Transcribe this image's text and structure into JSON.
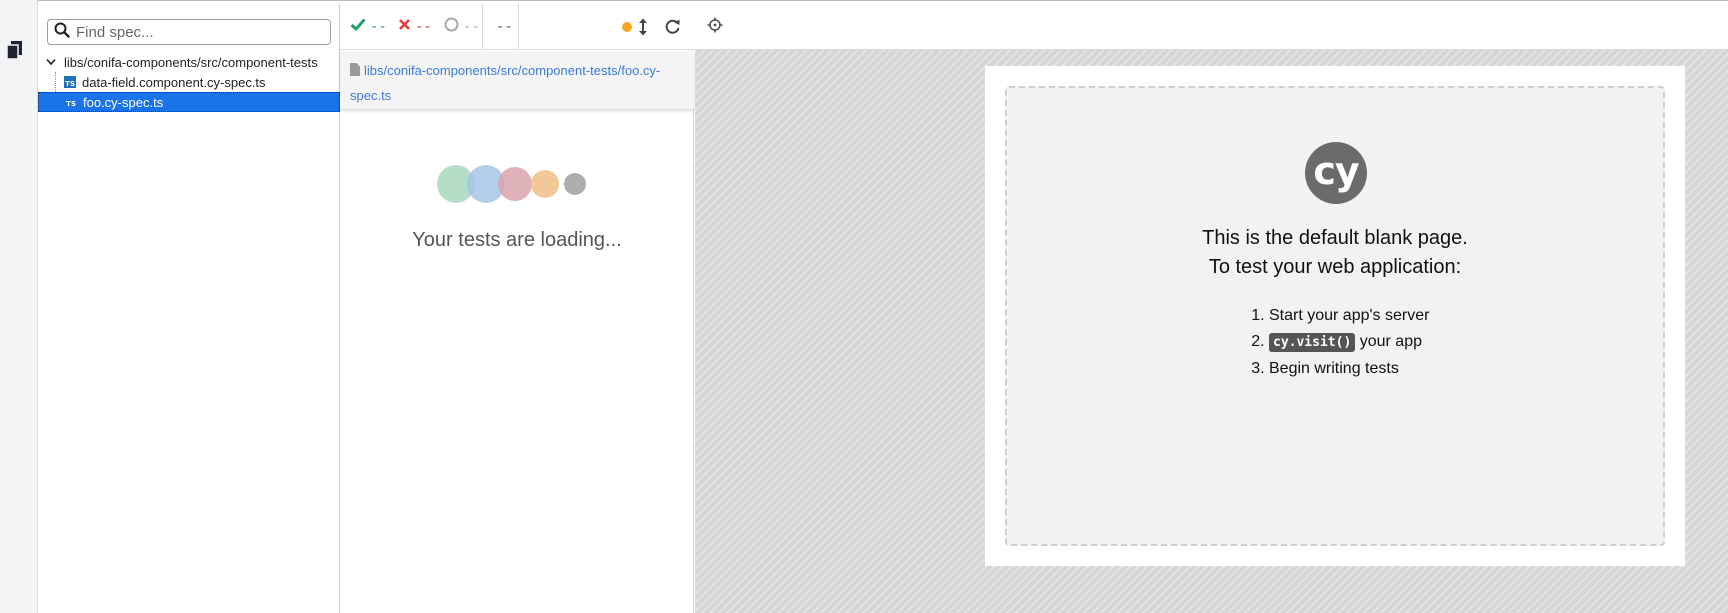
{
  "search": {
    "placeholder": "Find spec..."
  },
  "tree": {
    "folder": "libs/conifa-components/src/component-tests",
    "files": [
      {
        "label": "data-field.component.cy-spec.ts",
        "badge": "TS",
        "selected": false
      },
      {
        "label": "foo.cy-spec.ts",
        "badge": "TS",
        "selected": true
      }
    ]
  },
  "stats": {
    "passed": "--",
    "failed": "--",
    "pending": "--",
    "duration": "--"
  },
  "spec_path": "libs/conifa-components/src/component-tests/foo.cy-spec.ts",
  "loading_text": "Your tests are loading...",
  "loader_colors": [
    "#a8d8c0",
    "#a7c4e6",
    "#d9a3ad",
    "#eec28f",
    "#a9a9a9"
  ],
  "blank_page": {
    "logo_text": "cy",
    "heading_line1": "This is the default blank page.",
    "heading_line2": "To test your web application:",
    "step1": "Start your app's server",
    "step2_code": "cy.visit()",
    "step2_text": "your app",
    "step3": "Begin writing tests"
  },
  "colors": {
    "selected": "#1a73e8",
    "passed": "#22a06b",
    "failed": "#e03b3b",
    "running": "#f5a623",
    "link": "#3b7bd8"
  }
}
